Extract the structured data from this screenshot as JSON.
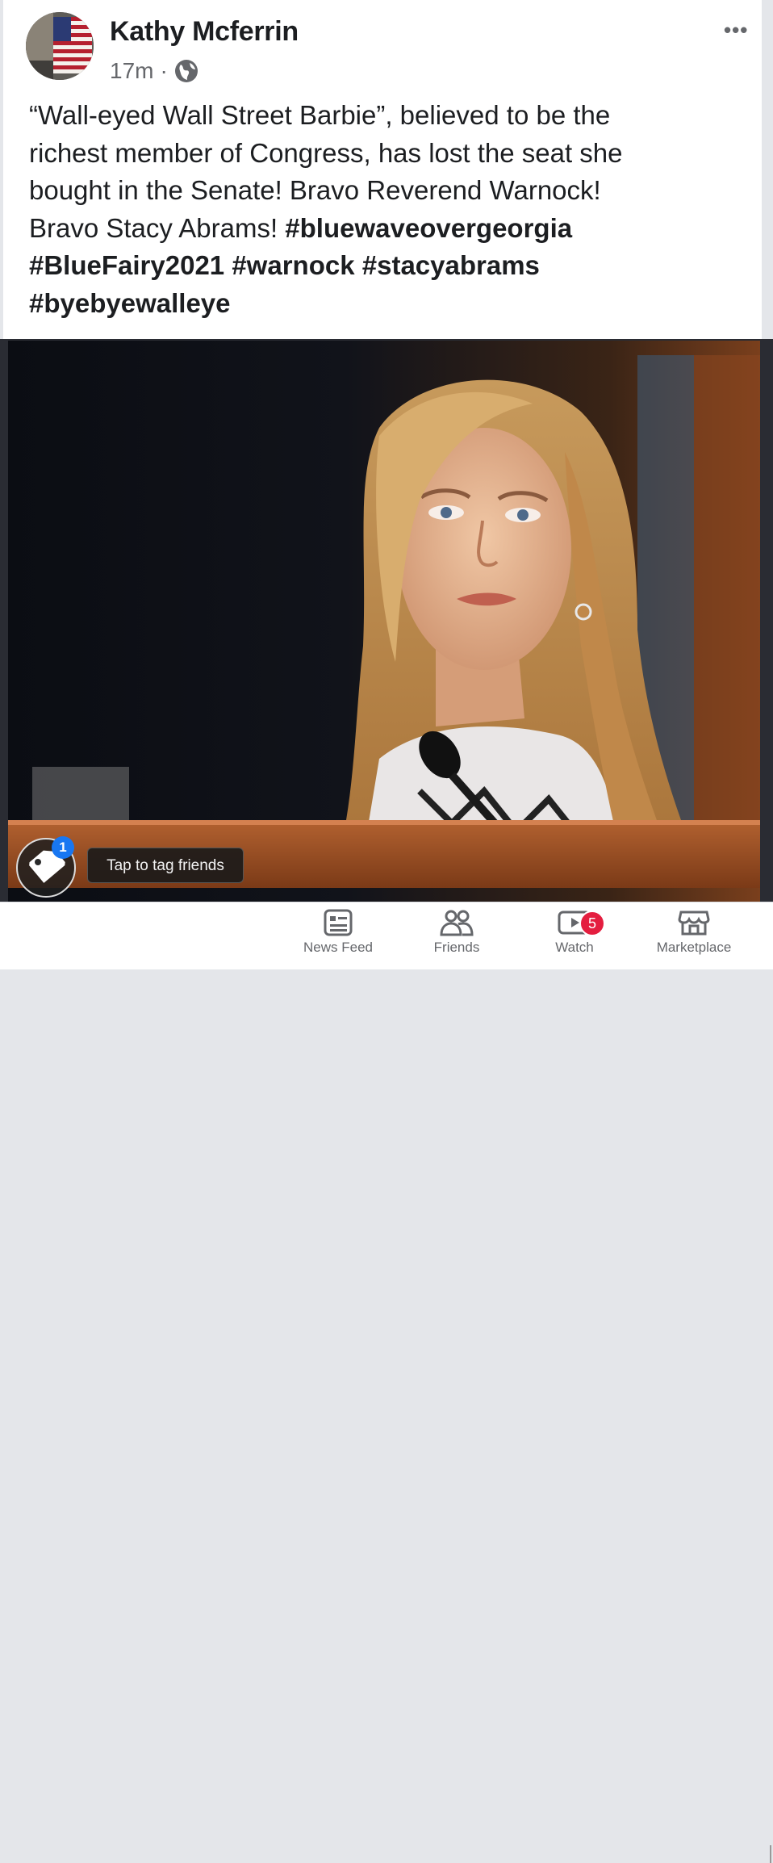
{
  "post": {
    "author": "Kathy Mcferrin",
    "time": "17m",
    "privacy_separator": "·",
    "more_label": "•••",
    "text_lines": [
      "“Wall-eyed Wall Street Barbie”, believed to be the",
      "richest member of Congress, has lost the seat she",
      "bought in the Senate! Bravo Reverend Warnock!",
      "Bravo Stacy Abrams! "
    ],
    "hashtags": [
      "#bluewaveovergeorgia",
      "#BlueFairy2021",
      "#warnock",
      "#stacyabrams",
      "#byebyewalleye"
    ]
  },
  "photo": {
    "tag_count": "1",
    "tag_tooltip": "Tap to tag friends"
  },
  "nav": {
    "items": [
      {
        "label": "News Feed",
        "icon": "news-feed-icon"
      },
      {
        "label": "Friends",
        "icon": "friends-icon"
      },
      {
        "label": "Watch",
        "icon": "watch-icon",
        "badge": "5"
      },
      {
        "label": "Marketplace",
        "icon": "marketplace-icon"
      }
    ]
  },
  "colors": {
    "text": "#1c1e21",
    "secondary": "#65676b",
    "badge_red": "#e41e3f",
    "facebook_blue": "#1877f2"
  }
}
